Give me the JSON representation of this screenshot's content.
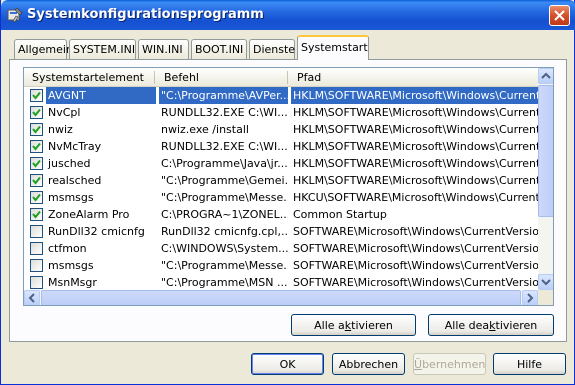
{
  "window": {
    "title": "Systemkonfigurationsprogramm"
  },
  "tabs": [
    {
      "label": "Allgemein",
      "active": false
    },
    {
      "label": "SYSTEM.INI",
      "active": false
    },
    {
      "label": "WIN.INI",
      "active": false
    },
    {
      "label": "BOOT.INI",
      "active": false
    },
    {
      "label": "Dienste",
      "active": false
    },
    {
      "label": "Systemstart",
      "active": true
    }
  ],
  "list": {
    "columns": [
      "Systemstartelement",
      "Befehl",
      "Pfad"
    ],
    "rows": [
      {
        "checked": true,
        "selected": true,
        "name": "AVGNT",
        "command": "\"C:\\Programme\\AVPer...",
        "path": "HKLM\\SOFTWARE\\Microsoft\\Windows\\CurrentVer..."
      },
      {
        "checked": true,
        "selected": false,
        "name": "NvCpl",
        "command": "RUNDLL32.EXE C:\\WI...",
        "path": "HKLM\\SOFTWARE\\Microsoft\\Windows\\CurrentVer..."
      },
      {
        "checked": true,
        "selected": false,
        "name": "nwiz",
        "command": "nwiz.exe /install",
        "path": "HKLM\\SOFTWARE\\Microsoft\\Windows\\CurrentVer..."
      },
      {
        "checked": true,
        "selected": false,
        "name": "NvMcTray",
        "command": "RUNDLL32.EXE C:\\WI...",
        "path": "HKLM\\SOFTWARE\\Microsoft\\Windows\\CurrentVer..."
      },
      {
        "checked": true,
        "selected": false,
        "name": "jusched",
        "command": "C:\\Programme\\Java\\jr...",
        "path": "HKLM\\SOFTWARE\\Microsoft\\Windows\\CurrentVer..."
      },
      {
        "checked": true,
        "selected": false,
        "name": "realsched",
        "command": "\"C:\\Programme\\Gemei...",
        "path": "HKLM\\SOFTWARE\\Microsoft\\Windows\\CurrentVer..."
      },
      {
        "checked": true,
        "selected": false,
        "name": "msmsgs",
        "command": "\"C:\\Programme\\Messe...",
        "path": "HKCU\\SOFTWARE\\Microsoft\\Windows\\CurrentVer..."
      },
      {
        "checked": true,
        "selected": false,
        "name": "ZoneAlarm Pro",
        "command": "C:\\PROGRA~1\\ZONEL...",
        "path": "Common Startup"
      },
      {
        "checked": false,
        "selected": false,
        "name": "RunDll32 cmicnfg",
        "command": "RunDll32 cmicnfg.cpl,...",
        "path": "SOFTWARE\\Microsoft\\Windows\\CurrentVersion\\Ru"
      },
      {
        "checked": false,
        "selected": false,
        "name": "ctfmon",
        "command": "C:\\WINDOWS\\System...",
        "path": "SOFTWARE\\Microsoft\\Windows\\CurrentVersion\\Ru"
      },
      {
        "checked": false,
        "selected": false,
        "name": "msmsgs",
        "command": "\"C:\\Programme\\Messe...",
        "path": "SOFTWARE\\Microsoft\\Windows\\CurrentVersion\\Ru"
      },
      {
        "checked": false,
        "selected": false,
        "name": "MsnMsgr",
        "command": "\"C:\\Programme\\MSN ...",
        "path": "SOFTWARE\\Microsoft\\Windows\\CurrentVersion\\Ru"
      }
    ]
  },
  "buttons": {
    "enable_all": {
      "pre": "Alle a",
      "key": "k",
      "post": "tivieren"
    },
    "disable_all": {
      "pre": "Alle dea",
      "key": "k",
      "post": "tivieren"
    },
    "ok": "OK",
    "cancel": "Abbrechen",
    "apply": {
      "key": "Ü",
      "post": "bernehmen"
    },
    "help": "Hilfe"
  },
  "colors": {
    "selection": "#316ac5",
    "titlebar": "#2467e0",
    "checkmark": "#21a121"
  }
}
